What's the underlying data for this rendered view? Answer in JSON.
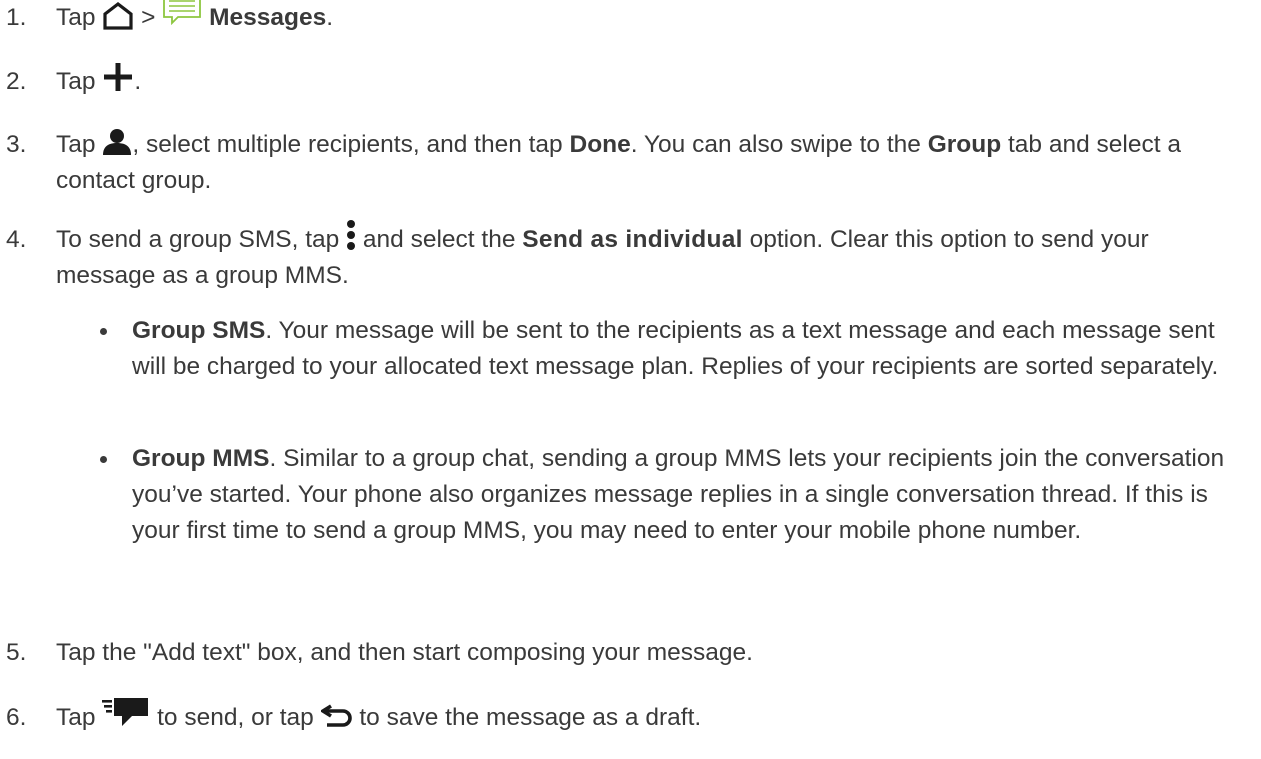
{
  "steps": [
    {
      "number": "1.",
      "tap": "Tap",
      "sep": ">",
      "messages": "Messages",
      "end": "."
    },
    {
      "number": "2.",
      "tap": "Tap",
      "end": "."
    },
    {
      "number": "3.",
      "tap": "Tap",
      "after_icon": ", select multiple recipients, and then tap ",
      "done": "Done",
      "mid": ". You can also swipe to the ",
      "group": "Group",
      "tail": " tab and select a contact group."
    },
    {
      "number": "4.",
      "pre": "To send a group SMS, tap ",
      "mid": " and select the ",
      "option": "Send as individual",
      "tail": " option. Clear this option to send your message as a group MMS."
    },
    {
      "number": "5.",
      "text": "Tap the \"Add text\" box, and then start composing your message."
    },
    {
      "number": "6.",
      "tap": "Tap ",
      "mid": " to send, or tap ",
      "tail": " to save the message as a draft."
    }
  ],
  "bullets": [
    {
      "term": "Group SMS",
      "text": ". Your message will be sent to the recipients as a text message and each message sent will be charged to your allocated text message plan. Replies of your recipients are sorted separately."
    },
    {
      "term": "Group MMS",
      "text": ". Similar to a group chat, sending a group MMS lets your recipients join the conversation you’ve started. Your phone also organizes message replies in a single conversation thread. If this is your first time to send a group MMS, you may need to enter your mobile phone number."
    }
  ],
  "icons": {
    "home": "home-icon",
    "messages": "messages-app-icon",
    "plus": "plus-icon",
    "contact": "person-icon",
    "menu": "more-vertical-icon",
    "send": "send-icon",
    "back": "back-icon",
    "messages_color": "#8dc63f"
  }
}
